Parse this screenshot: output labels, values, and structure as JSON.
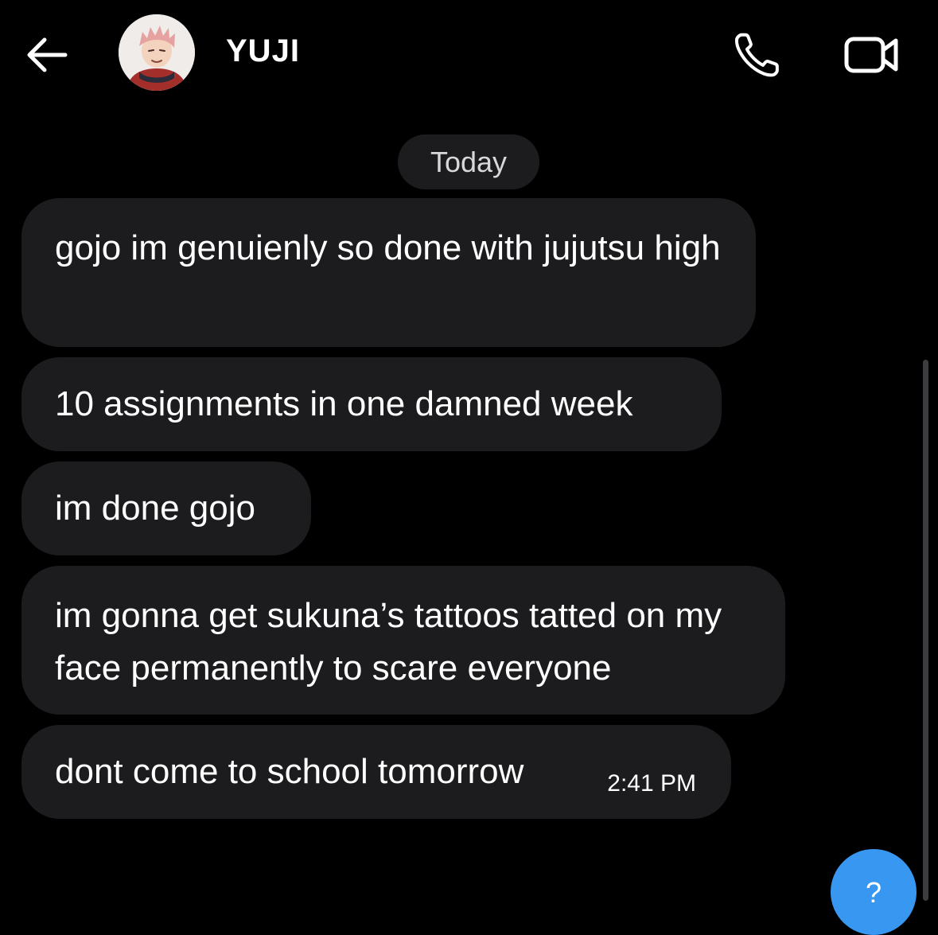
{
  "header": {
    "contact_name": "YUJI",
    "back_icon": "arrow-left-icon",
    "call_icon": "phone-icon",
    "video_icon": "video-camera-icon"
  },
  "conversation": {
    "date_separator": "Today",
    "messages": [
      {
        "text": "gojo im genuienly so done with jujutsu high"
      },
      {
        "text": "10 assignments in one damned week"
      },
      {
        "text": "im done gojo"
      },
      {
        "text": "im gonna get sukuna’s tattoos tatted on my face permanently to scare everyone"
      },
      {
        "text": "dont come to school tomorrow",
        "time": "2:41 PM"
      }
    ]
  },
  "fab": {
    "label": "?"
  },
  "colors": {
    "background": "#000000",
    "bubble": "#1c1c1e",
    "accent": "#3897f0"
  }
}
